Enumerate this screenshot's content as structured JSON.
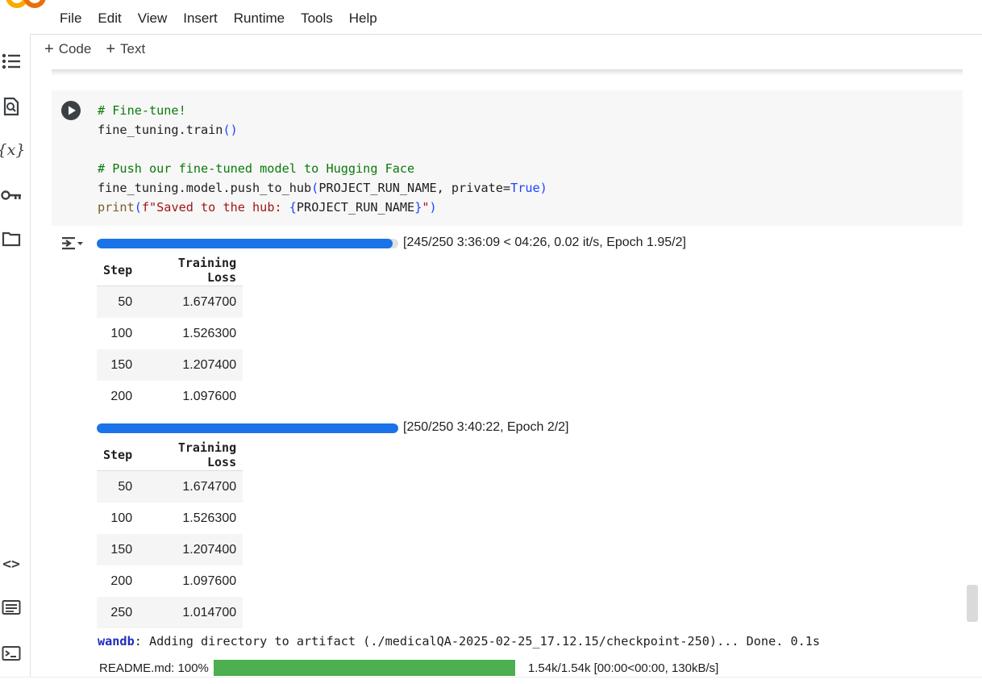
{
  "app": {
    "title_fragment": "",
    "menu": [
      "File",
      "Edit",
      "View",
      "Insert",
      "Runtime",
      "Tools",
      "Help"
    ]
  },
  "toolbar": {
    "code_label": "Code",
    "text_label": "Text"
  },
  "rail_icons": [
    "table-of-contents-icon",
    "find-replace-icon",
    "variables-icon",
    "secrets-key-icon",
    "files-folder-icon",
    "code-snippets-icon",
    "command-palette-icon",
    "terminal-icon"
  ],
  "cell": {
    "code_lines": [
      "# Fine-tune!",
      "fine_tuning.train()",
      "",
      "# Push our fine-tuned model to Hugging Face",
      "fine_tuning.model.push_to_hub(PROJECT_RUN_NAME, private=True)",
      "print(f\"Saved to the hub: {PROJECT_RUN_NAME}\")"
    ]
  },
  "output": {
    "progress_1": {
      "text": "[245/250 3:36:09 < 04:26, 0.02 it/s, Epoch 1.95/2]",
      "fraction": 0.98
    },
    "table_1": {
      "headers": [
        "Step",
        "Training Loss"
      ],
      "rows": [
        [
          "50",
          "1.674700"
        ],
        [
          "100",
          "1.526300"
        ],
        [
          "150",
          "1.207400"
        ],
        [
          "200",
          "1.097600"
        ]
      ]
    },
    "progress_2": {
      "text": "[250/250 3:40:22, Epoch 2/2]",
      "fraction": 1.0
    },
    "table_2": {
      "headers": [
        "Step",
        "Training Loss"
      ],
      "rows": [
        [
          "50",
          "1.674700"
        ],
        [
          "100",
          "1.526300"
        ],
        [
          "150",
          "1.207400"
        ],
        [
          "200",
          "1.097600"
        ],
        [
          "250",
          "1.014700"
        ]
      ]
    },
    "wandb": {
      "tag": "wandb",
      "message": ": Adding directory to artifact (./medicalQA-2025-02-25_17.12.15/checkpoint-250)... Done. 0.1s"
    },
    "readme": {
      "label": "README.md: 100%",
      "fraction": 1.0,
      "stats": "1.54k/1.54k [00:00<00:00, 130kB/s]"
    }
  },
  "colors": {
    "progress_blue": "#1a73e8",
    "readme_green": "#4caf50",
    "logo_orange": "#f9ab00"
  }
}
